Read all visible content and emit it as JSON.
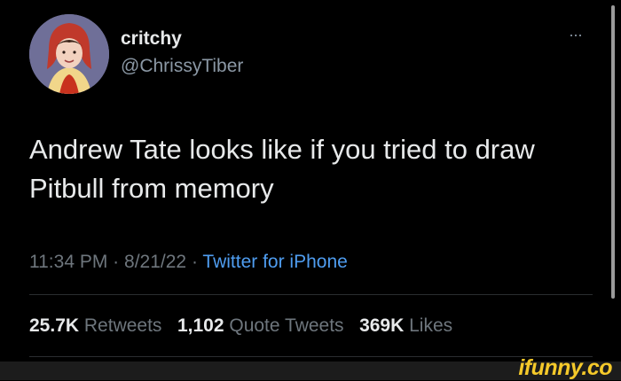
{
  "author": {
    "display_name": "critchy",
    "handle": "@ChrissyTiber"
  },
  "tweet": {
    "text": "Andrew Tate looks like if you tried to draw Pitbull from memory",
    "time": "11:34 PM",
    "date": "8/21/22",
    "separator": "·",
    "source": "Twitter for iPhone"
  },
  "stats": {
    "retweets_count": "25.7K",
    "retweets_label": "Retweets",
    "quotes_count": "1,102",
    "quotes_label": "Quote Tweets",
    "likes_count": "369K",
    "likes_label": "Likes"
  },
  "watermark": "ifunny.co",
  "colors": {
    "background": "#000000",
    "link": "#4f9df0",
    "brand": "#f5c92a"
  }
}
